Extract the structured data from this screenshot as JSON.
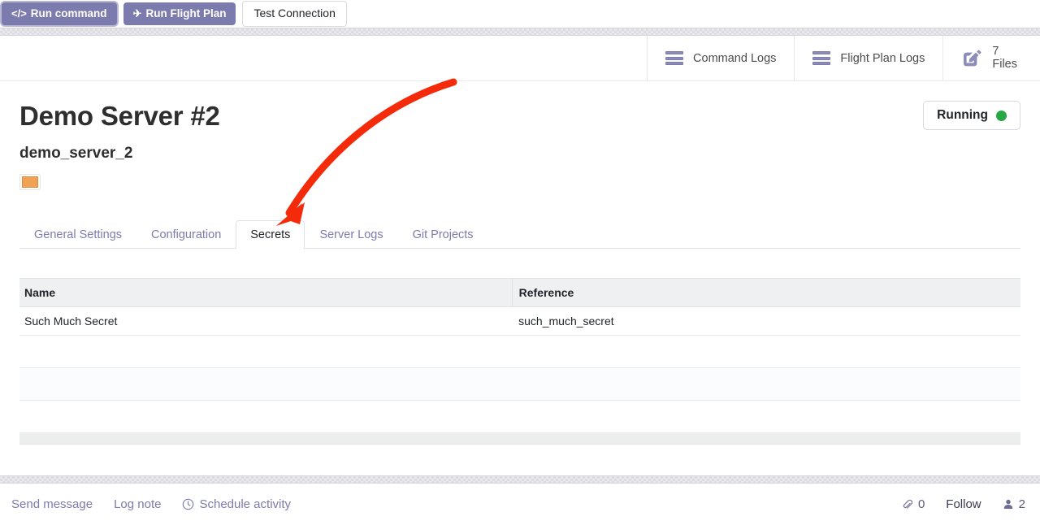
{
  "control_panel": {
    "buttons": [
      {
        "label": "Run command",
        "icon": "code-icon",
        "glyph": "</>",
        "style": "primary",
        "focused": true
      },
      {
        "label": "Run Flight Plan",
        "icon": "airplane-icon",
        "glyph": "✈",
        "style": "primary",
        "focused": false
      },
      {
        "label": "Test Connection",
        "icon": null,
        "glyph": "",
        "style": "secondary",
        "focused": false
      }
    ]
  },
  "stat_buttons": [
    {
      "icon": "list-icon",
      "label": "Command Logs",
      "value": null
    },
    {
      "icon": "list-icon",
      "label": "Flight Plan Logs",
      "value": null
    },
    {
      "icon": "edit-document-icon",
      "label": "Files",
      "value": "7"
    }
  ],
  "record": {
    "title": "Demo Server #2",
    "subtitle": "demo_server_2",
    "color_swatch": "#f0a154",
    "status": {
      "label": "Running",
      "dot_color": "#28a745"
    }
  },
  "tabs": [
    {
      "label": "General Settings",
      "active": false
    },
    {
      "label": "Configuration",
      "active": false
    },
    {
      "label": "Secrets",
      "active": true
    },
    {
      "label": "Server Logs",
      "active": false
    },
    {
      "label": "Git Projects",
      "active": false
    }
  ],
  "secrets_table": {
    "columns": [
      "Name",
      "Reference"
    ],
    "rows": [
      {
        "name": "Such Much Secret",
        "reference": "such_much_secret"
      }
    ],
    "empty_row_count": 3
  },
  "chatter": {
    "send_message": "Send message",
    "log_note": "Log note",
    "schedule_activity": "Schedule activity",
    "schedule_icon": "clock-icon",
    "attachment_icon": "paperclip-icon",
    "attachment_count": "0",
    "follow_label": "Follow",
    "followers_icon": "person-icon",
    "followers_count": "2"
  },
  "annotation": {
    "type": "arrow",
    "color": "#f42b0a",
    "points_to": "Secrets"
  }
}
